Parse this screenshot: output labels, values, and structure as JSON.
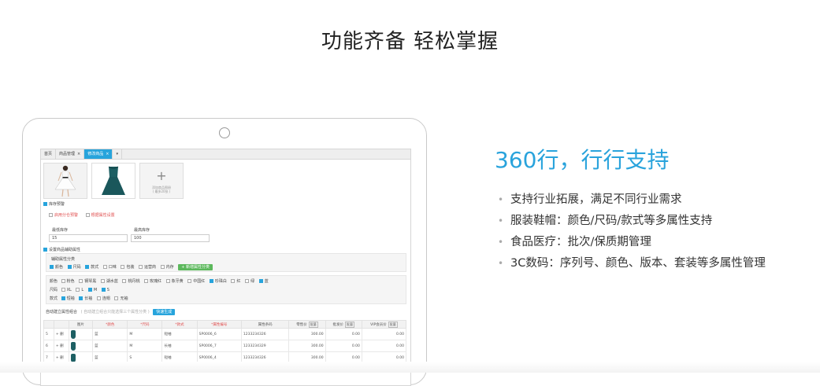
{
  "headline": "功能齐备 轻松掌握",
  "screen": {
    "tabs": [
      {
        "label": "首页",
        "active": false
      },
      {
        "label": "商品管理",
        "active": false,
        "close": "×"
      },
      {
        "label": "修改商品",
        "active": true,
        "close": "×"
      },
      {
        "label": "▾",
        "active": false
      }
    ],
    "add_image": {
      "plus": "+",
      "line1": "添加商品图册",
      "line2": "( 最多20张 )"
    },
    "stock_warning": "库存预警",
    "enable_warning": "启用分仓预警",
    "by_attribute": "根据属性设置",
    "min_stock_label": "最低库存",
    "max_stock_label": "最高库存",
    "min_stock_value": "15",
    "max_stock_value": "100",
    "aux_attr": "设置商品辅助属性",
    "aux_category": "辅助属性分类",
    "categories": [
      {
        "label": "颜色",
        "on": true
      },
      {
        "label": "尺码",
        "on": true
      },
      {
        "label": "款式",
        "on": true
      },
      {
        "label": "口味",
        "on": false
      },
      {
        "label": "包装",
        "on": false
      },
      {
        "label": "运营商",
        "on": false
      },
      {
        "label": "内存",
        "on": false
      }
    ],
    "add_category_btn": "+ 新增属性分类",
    "color_label": "颜色",
    "colors": [
      {
        "label": "粉色",
        "on": false
      },
      {
        "label": "钢琴黑",
        "on": false
      },
      {
        "label": "湖水蓝",
        "on": false
      },
      {
        "label": "桃丹桃",
        "on": false
      },
      {
        "label": "玫瑰红",
        "on": false
      },
      {
        "label": "象牙黄",
        "on": false
      },
      {
        "label": "中国红",
        "on": false
      },
      {
        "label": "珍珠白",
        "on": true
      },
      {
        "label": "红",
        "on": false
      },
      {
        "label": "绿",
        "on": false
      },
      {
        "label": "蓝",
        "on": true
      }
    ],
    "size_label": "尺码",
    "sizes": [
      {
        "label": "XL",
        "on": false
      },
      {
        "label": "L",
        "on": false
      },
      {
        "label": "M",
        "on": true
      },
      {
        "label": "S",
        "on": true
      }
    ],
    "style_label": "款式",
    "styles": [
      {
        "label": "短袖",
        "on": true
      },
      {
        "label": "长袖",
        "on": true
      },
      {
        "label": "连帽",
        "on": false
      },
      {
        "label": "无袖",
        "on": false
      }
    ],
    "auto_combo": "自动建立属性组合",
    "auto_combo_hint": "( 自动建立组合只能选择三个属性分类 )",
    "quick_gen_btn": "快速生成",
    "table": {
      "headers": [
        "",
        "",
        "图片",
        "*颜色",
        "*尺码",
        "*款式",
        "*属性编号",
        "属性条码",
        "零售价",
        "批发价",
        "VIP会员价"
      ],
      "batch": "批量",
      "rows": [
        {
          "no": "5",
          "ops": "+ 删",
          "color": "蓝",
          "size": "M",
          "style": "短袖",
          "code": "SP0006_6",
          "barcode": "1233234326",
          "retail": "300.00",
          "wholesale": "0.00",
          "vip": "0.00"
        },
        {
          "no": "6",
          "ops": "+ 删",
          "color": "蓝",
          "size": "M",
          "style": "长袖",
          "code": "SP0006_7",
          "barcode": "1233234329",
          "retail": "300.00",
          "wholesale": "0.00",
          "vip": "0.00"
        },
        {
          "no": "7",
          "ops": "+ 删",
          "color": "蓝",
          "size": "S",
          "style": "短袖",
          "code": "SP0006_4",
          "barcode": "1233234326",
          "retail": "300.00",
          "wholesale": "0.00",
          "vip": "0.00"
        }
      ]
    }
  },
  "subtitle": "360行，行行支持",
  "bullet_glyph": "•",
  "features": [
    "支持行业拓展，满足不同行业需求",
    "服装鞋帽：颜色/尺码/款式等多属性支持",
    "食品医疗：批次/保质期管理",
    "3C数码：序列号、颜色、版本、套装等多属性管理"
  ],
  "colors": {
    "accent": "#29a3dc",
    "tab_active": "#27a4dc",
    "green_btn": "#5cb85c",
    "dress": "#1d5f63",
    "warning": "#e05050"
  }
}
